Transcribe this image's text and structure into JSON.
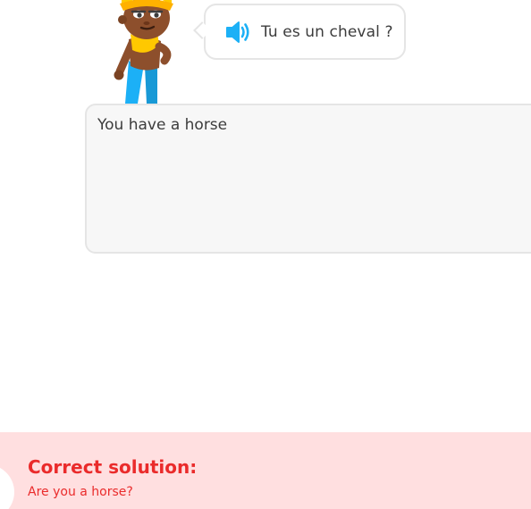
{
  "challenge": {
    "prompt_text": "Tu es un cheval ?",
    "speaker_icon": "speaker-icon",
    "character_icon": "character-icon"
  },
  "answer": {
    "value": "You have a horse"
  },
  "feedback": {
    "title": "Correct solution:",
    "solution": "Are you a horse?",
    "status_color": "#ea2b2b",
    "background_color": "#ffdfe0"
  },
  "colors": {
    "accent_blue": "#1cb0f6",
    "text_dark": "#3c3c3c",
    "border": "#e5e5e5"
  }
}
